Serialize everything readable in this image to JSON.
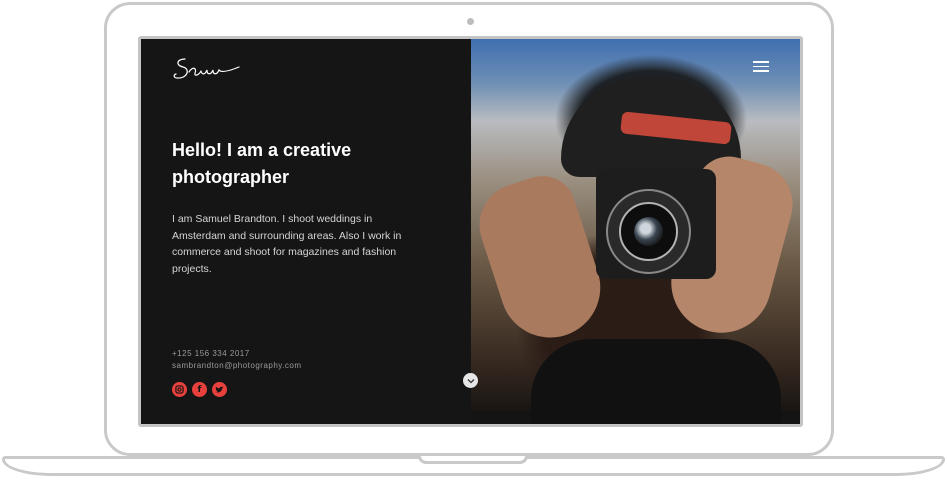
{
  "hero": {
    "headline": "Hello! I am a creative photographer",
    "intro": "I am Samuel Brandton. I shoot weddings in Amsterdam and surrounding areas. Also I work in commerce and shoot for magazines and fashion projects."
  },
  "contact": {
    "phone": "+125 156 334 2017",
    "email": "sambrandton@photography.com"
  },
  "social": [
    {
      "name": "instagram",
      "glyph": "◎"
    },
    {
      "name": "facebook",
      "glyph": "f"
    },
    {
      "name": "twitter",
      "glyph": "t"
    }
  ],
  "colors": {
    "accent": "#e8403c",
    "panel": "#151515"
  },
  "icons": {
    "logo": "signature-logo-icon",
    "menu": "hamburger-menu-icon",
    "scroll": "chevron-down-icon"
  }
}
